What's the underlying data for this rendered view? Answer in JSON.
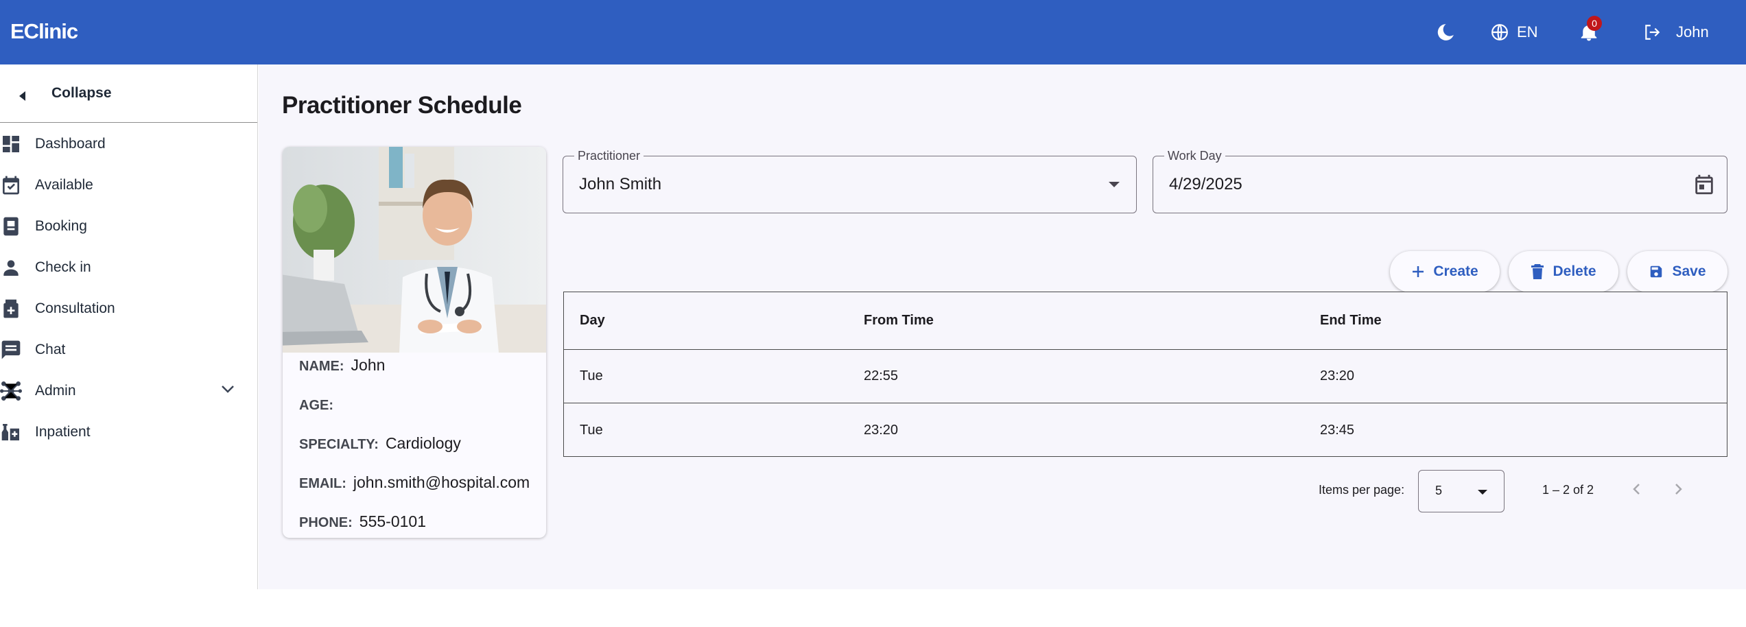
{
  "app": {
    "brand": "EClinic"
  },
  "header": {
    "language": "EN",
    "notifications_count": "0",
    "user_name": "John",
    "icons": [
      "moon-icon",
      "globe-icon",
      "bell-icon",
      "logout-icon"
    ]
  },
  "sidebar": {
    "collapse_label": "Collapse",
    "items": [
      {
        "label": "Dashboard",
        "icon": "dashboard-icon"
      },
      {
        "label": "Available",
        "icon": "calendar-check-icon"
      },
      {
        "label": "Booking",
        "icon": "booking-icon"
      },
      {
        "label": "Check in",
        "icon": "person-icon"
      },
      {
        "label": "Consultation",
        "icon": "medical-case-icon"
      },
      {
        "label": "Chat",
        "icon": "chat-icon"
      },
      {
        "label": "Admin",
        "icon": "hub-icon"
      },
      {
        "label": "Inpatient",
        "icon": "inpatient-icon"
      }
    ]
  },
  "page": {
    "title": "Practitioner Schedule"
  },
  "profile": {
    "name_label": "NAME:",
    "name": "John",
    "age_label": "AGE:",
    "age": "",
    "specialty_label": "SPECIALTY:",
    "specialty": "Cardiology",
    "email_label": "EMAIL:",
    "email": "john.smith@hospital.com",
    "phone_label": "PHONE:",
    "phone": "555-0101"
  },
  "form": {
    "practitioner_label": "Practitioner",
    "practitioner_value": "John Smith",
    "workday_label": "Work Day",
    "workday_value": "4/29/2025"
  },
  "actions": {
    "create": "Create",
    "delete": "Delete",
    "save": "Save"
  },
  "table": {
    "columns": [
      "Day",
      "From Time",
      "End Time"
    ],
    "rows": [
      [
        "Tue",
        "22:55",
        "23:20"
      ],
      [
        "Tue",
        "23:20",
        "23:45"
      ]
    ]
  },
  "paginator": {
    "items_per_page_label": "Items per page:",
    "page_size": "5",
    "range": "1 – 2 of 2"
  },
  "colors": {
    "primary": "#2f5ec0",
    "badge": "#c0161b",
    "background": "#f7f6fc"
  }
}
